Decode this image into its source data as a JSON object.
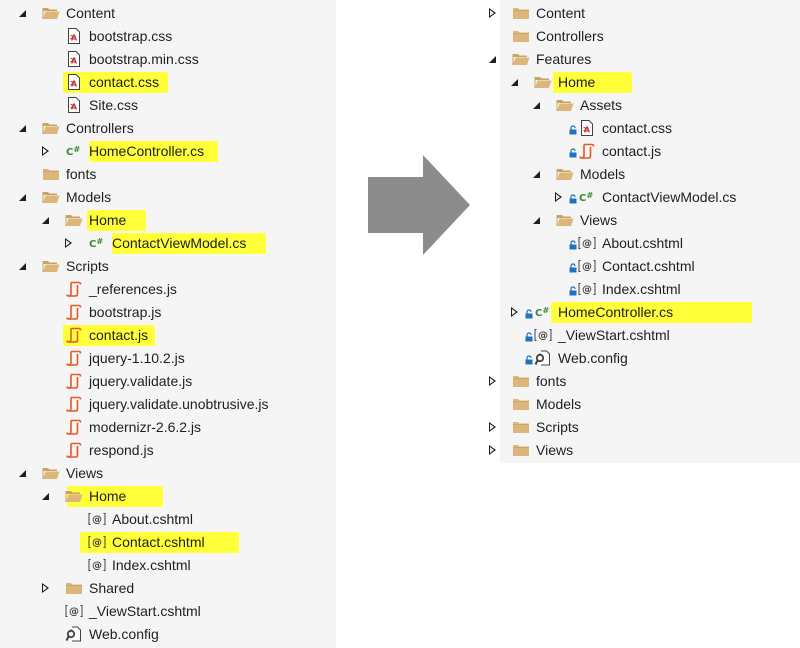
{
  "colors": {
    "panel_bg": "#f5f5f5",
    "highlight": "#ffff3a",
    "folder": "#dcb67a",
    "css_red": "#c5303a",
    "js_orange": "#e65925",
    "csharp_green": "#388a34",
    "lock_blue": "#1e73be",
    "arrow_gray": "#8c8c8c"
  },
  "left_tree": [
    {
      "label": "Content",
      "icon": "folder-open-icon",
      "expander": "open"
    },
    {
      "label": "bootstrap.css",
      "icon": "css-file-icon",
      "expander": "none"
    },
    {
      "label": "bootstrap.min.css",
      "icon": "css-file-icon",
      "expander": "none"
    },
    {
      "label": "contact.css",
      "icon": "css-file-icon",
      "expander": "none",
      "highlight": true
    },
    {
      "label": "Site.css",
      "icon": "css-file-icon",
      "expander": "none"
    },
    {
      "label": "Controllers",
      "icon": "folder-open-icon",
      "expander": "open"
    },
    {
      "label": "HomeController.cs",
      "icon": "csharp-icon",
      "expander": "closed",
      "highlight": true
    },
    {
      "label": "fonts",
      "icon": "folder-icon",
      "expander": "none"
    },
    {
      "label": "Models",
      "icon": "folder-open-icon",
      "expander": "open"
    },
    {
      "label": "Home",
      "icon": "folder-open-icon",
      "expander": "open",
      "highlight": true
    },
    {
      "label": "ContactViewModel.cs",
      "icon": "csharp-icon",
      "expander": "closed",
      "highlight": true
    },
    {
      "label": "Scripts",
      "icon": "folder-open-icon",
      "expander": "open"
    },
    {
      "label": "_references.js",
      "icon": "js-file-icon",
      "expander": "none"
    },
    {
      "label": "bootstrap.js",
      "icon": "js-file-icon",
      "expander": "none"
    },
    {
      "label": "contact.js",
      "icon": "js-file-icon",
      "expander": "none",
      "highlight": true
    },
    {
      "label": "jquery-1.10.2.js",
      "icon": "js-file-icon",
      "expander": "none"
    },
    {
      "label": "jquery.validate.js",
      "icon": "js-file-icon",
      "expander": "none"
    },
    {
      "label": "jquery.validate.unobtrusive.js",
      "icon": "js-file-icon",
      "expander": "none"
    },
    {
      "label": "modernizr-2.6.2.js",
      "icon": "js-file-icon",
      "expander": "none"
    },
    {
      "label": "respond.js",
      "icon": "js-file-icon",
      "expander": "none"
    },
    {
      "label": "Views",
      "icon": "folder-open-icon",
      "expander": "open"
    },
    {
      "label": "Home",
      "icon": "folder-open-icon",
      "expander": "open",
      "highlight": true
    },
    {
      "label": "About.cshtml",
      "icon": "razor-file-icon",
      "expander": "none"
    },
    {
      "label": "Contact.cshtml",
      "icon": "razor-file-icon",
      "expander": "none",
      "highlight": true
    },
    {
      "label": "Index.cshtml",
      "icon": "razor-file-icon",
      "expander": "none"
    },
    {
      "label": "Shared",
      "icon": "folder-icon",
      "expander": "closed"
    },
    {
      "label": "_ViewStart.cshtml",
      "icon": "razor-file-icon",
      "expander": "none"
    },
    {
      "label": "Web.config",
      "icon": "config-file-icon",
      "expander": "none"
    }
  ],
  "right_tree": [
    {
      "label": "Content",
      "icon": "folder-icon",
      "expander": "closed"
    },
    {
      "label": "Controllers",
      "icon": "folder-icon",
      "expander": "none"
    },
    {
      "label": "Features",
      "icon": "folder-open-icon",
      "expander": "open"
    },
    {
      "label": "Home",
      "icon": "folder-open-icon",
      "expander": "open",
      "highlight": true
    },
    {
      "label": "Assets",
      "icon": "folder-open-icon",
      "expander": "open"
    },
    {
      "label": "contact.css",
      "icon": "css-file-icon",
      "expander": "none",
      "lock": true
    },
    {
      "label": "contact.js",
      "icon": "js-file-icon",
      "expander": "none",
      "lock": true
    },
    {
      "label": "Models",
      "icon": "folder-open-icon",
      "expander": "open"
    },
    {
      "label": "ContactViewModel.cs",
      "icon": "csharp-icon",
      "expander": "closed",
      "lock": true
    },
    {
      "label": "Views",
      "icon": "folder-open-icon",
      "expander": "open"
    },
    {
      "label": "About.cshtml",
      "icon": "razor-file-icon",
      "expander": "none",
      "lock": true
    },
    {
      "label": "Contact.cshtml",
      "icon": "razor-file-icon",
      "expander": "none",
      "lock": true
    },
    {
      "label": "Index.cshtml",
      "icon": "razor-file-icon",
      "expander": "none",
      "lock": true
    },
    {
      "label": "HomeController.cs",
      "icon": "csharp-icon",
      "expander": "closed",
      "lock": true,
      "highlight": true
    },
    {
      "label": "_ViewStart.cshtml",
      "icon": "razor-file-icon",
      "expander": "none",
      "lock": true
    },
    {
      "label": "Web.config",
      "icon": "config-file-icon",
      "expander": "none",
      "lock": true
    },
    {
      "label": "fonts",
      "icon": "folder-icon",
      "expander": "closed"
    },
    {
      "label": "Models",
      "icon": "folder-icon",
      "expander": "none"
    },
    {
      "label": "Scripts",
      "icon": "folder-icon",
      "expander": "closed"
    },
    {
      "label": "Views",
      "icon": "folder-icon",
      "expander": "closed"
    }
  ]
}
